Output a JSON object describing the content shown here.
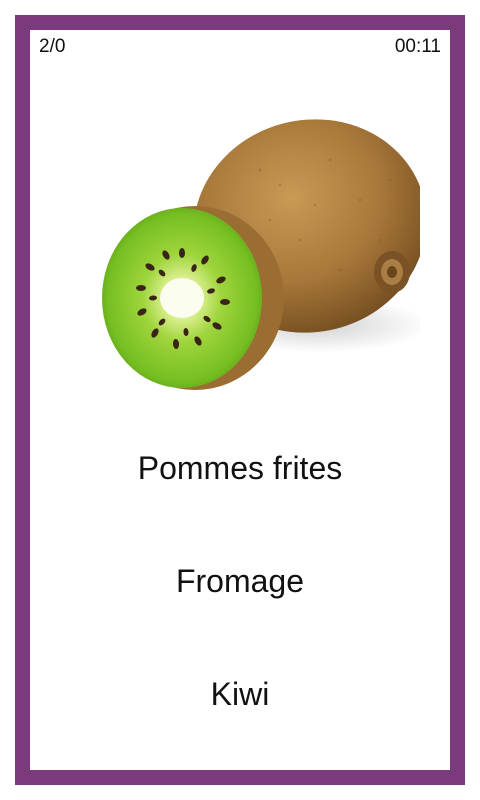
{
  "header": {
    "score": "2/0",
    "timer": "00:11"
  },
  "quiz": {
    "image_icon": "kiwi-fruit-image",
    "answers": [
      {
        "label": "Pommes frites"
      },
      {
        "label": "Fromage"
      },
      {
        "label": "Kiwi"
      }
    ]
  },
  "colors": {
    "frame": "#7b3a7b",
    "kiwi_skin": "#a87d3b",
    "kiwi_flesh": "#8bd12c"
  }
}
